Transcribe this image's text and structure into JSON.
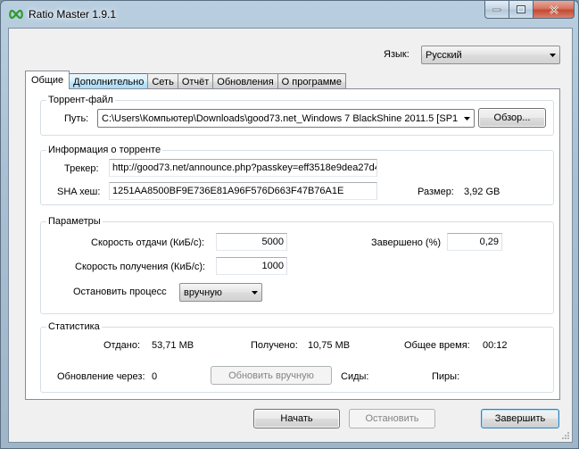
{
  "window": {
    "title": "Ratio Master 1.9.1",
    "accent": "#3c7fb1"
  },
  "language": {
    "label": "Язык:",
    "selected": "Русский"
  },
  "tabs": [
    {
      "label": "Общие",
      "active": true
    },
    {
      "label": "Дополнительно",
      "active": false
    },
    {
      "label": "Сеть",
      "active": false
    },
    {
      "label": "Отчёт",
      "active": false
    },
    {
      "label": "Обновления",
      "active": false
    },
    {
      "label": "О программе",
      "active": false
    }
  ],
  "torrent_file": {
    "title": "Торрент-файл",
    "path_label": "Путь:",
    "path_value": "C:\\Users\\Компьютер\\Downloads\\good73.net_Windows 7 BlackShine 2011.5 [SP1",
    "browse_label": "Обзор..."
  },
  "torrent_info": {
    "title": "Информация о торренте",
    "tracker_label": "Трекер:",
    "tracker_value": "http://good73.net/announce.php?passkey=eff3518e9dea27d4",
    "sha_label": "SHA хеш:",
    "sha_value": "1251AA8500BF9E736E81A96F576D663F47B76A1E",
    "size_label": "Размер:",
    "size_value": "3,92 GB"
  },
  "params": {
    "title": "Параметры",
    "upload_label": "Скорость отдачи (КиБ/с):",
    "upload_value": "5000",
    "download_label": "Скорость получения (КиБ/с):",
    "download_value": "1000",
    "stop_label": "Остановить процесс",
    "stop_selected": "вручную",
    "completed_label": "Завершено (%)",
    "completed_value": "0,29"
  },
  "stats": {
    "title": "Статистика",
    "sent_label": "Отдано:",
    "sent_value": "53,71 MB",
    "received_label": "Получено:",
    "received_value": "10,75 MB",
    "total_time_label": "Общее время:",
    "total_time_value": "00:12",
    "update_label": "Обновление через:",
    "update_value": "0",
    "update_button": "Обновить вручную",
    "seeds_label": "Сиды:",
    "peers_label": "Пиры:"
  },
  "footer": {
    "start_label": "Начать",
    "stop_label": "Остановить",
    "finish_label": "Завершить"
  },
  "icons": [
    "app-infinity-icon",
    "minimize-icon",
    "maximize-icon",
    "close-icon",
    "chevron-down-icon",
    "size-grip-icon"
  ]
}
